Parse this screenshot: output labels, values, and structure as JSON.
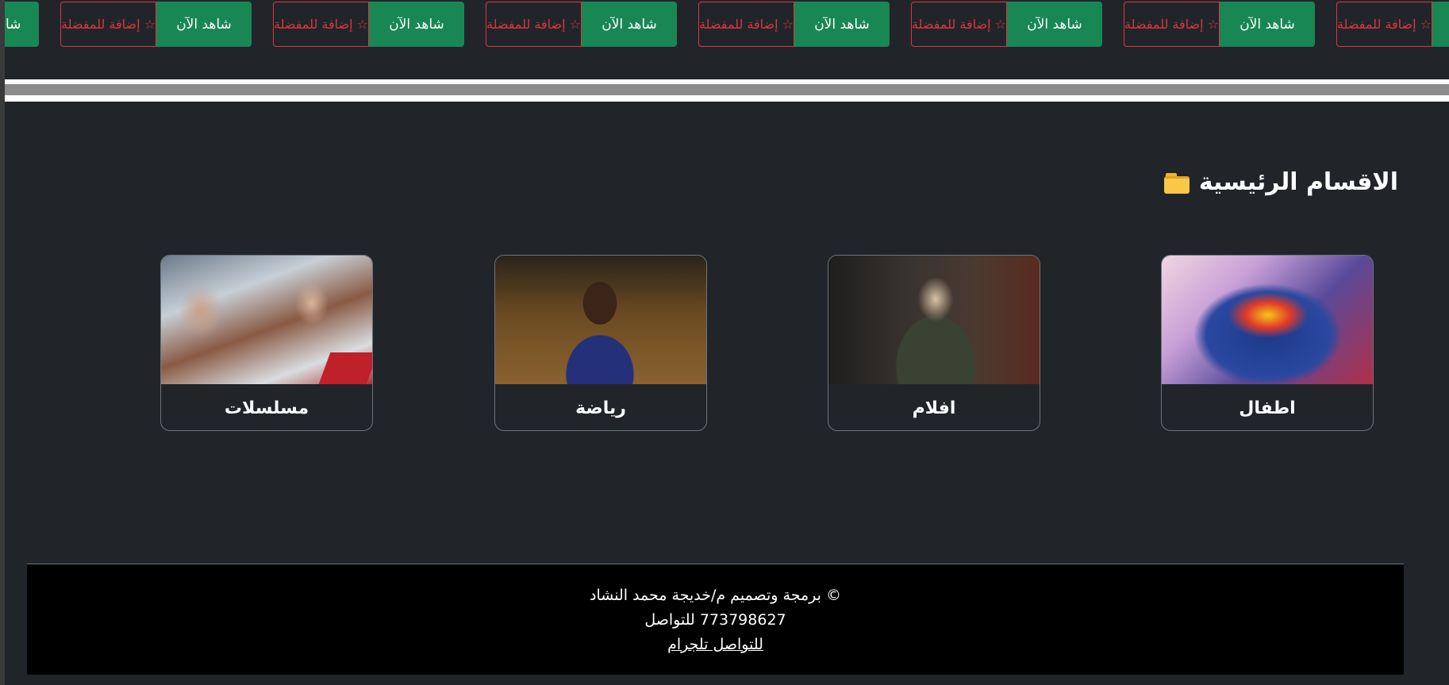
{
  "top_strip": {
    "partial_watch_label": "شا",
    "pairs": [
      {
        "fav_label": "☆ إضافة للمفضلة",
        "watch_label": "شاهد الآن"
      },
      {
        "fav_label": "☆ إضافة للمفضلة",
        "watch_label": "شاهد الآن"
      },
      {
        "fav_label": "☆ إضافة للمفضلة",
        "watch_label": "شاهد الآن"
      },
      {
        "fav_label": "☆ إضافة للمفضلة",
        "watch_label": "شاهد الآن"
      },
      {
        "fav_label": "☆ إضافة للمفضلة",
        "watch_label": "شاهد الآن"
      },
      {
        "fav_label": "☆ إضافة للمفضلة",
        "watch_label": "شاهد الآن"
      },
      {
        "fav_label": "☆ إضافة للمفضلة",
        "watch_label": ""
      }
    ]
  },
  "main": {
    "section_title": "الاقسام الرئيسية",
    "section_icon": "folder-icon",
    "categories": [
      {
        "label": "مسلسلات",
        "image": "series-poster"
      },
      {
        "label": "رياضة",
        "image": "basketball-player"
      },
      {
        "label": "افلام",
        "image": "movie-poster"
      },
      {
        "label": "اطفال",
        "image": "superman-emblem"
      }
    ]
  },
  "footer": {
    "credit": "© برمجة وتصميم م/خديجة محمد النشاد",
    "contact": "773798627 للتواصل",
    "telegram_link": "للتواصل تلجرام"
  },
  "colors": {
    "background": "#212529",
    "watch_button": "#198754",
    "fav_button": "#dc3545",
    "footer_bg": "#000000"
  }
}
